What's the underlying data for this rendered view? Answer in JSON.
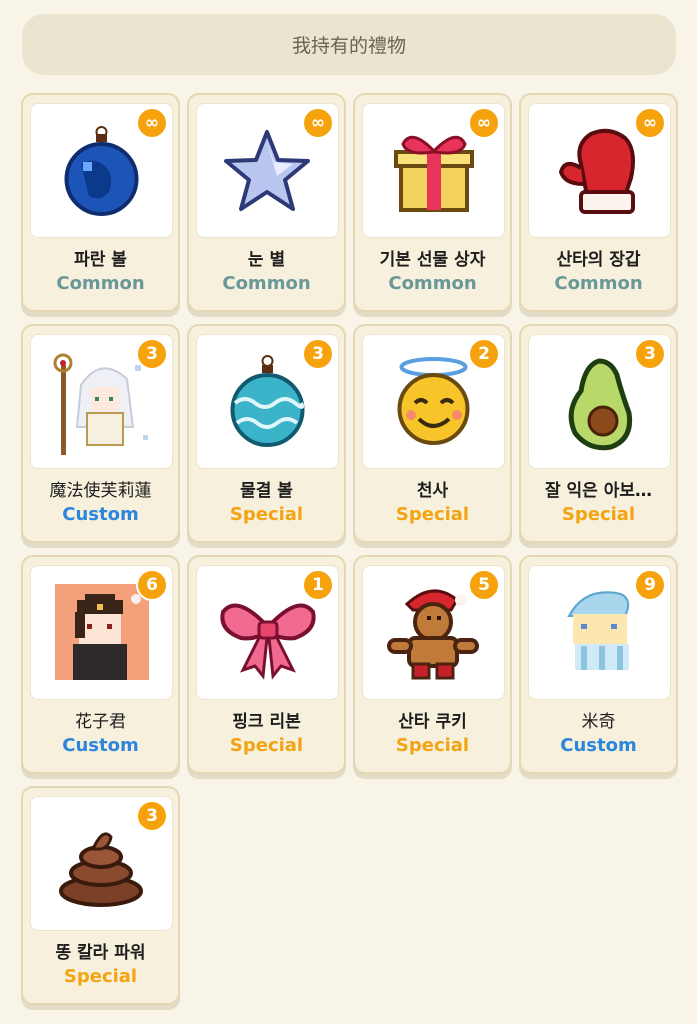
{
  "header": {
    "title": "我持有的禮物"
  },
  "items": [
    {
      "name": "파란 볼",
      "rarity": "Common",
      "count": "∞"
    },
    {
      "name": "눈 별",
      "rarity": "Common",
      "count": "∞"
    },
    {
      "name": "기본 선물 상자",
      "rarity": "Common",
      "count": "∞"
    },
    {
      "name": "산타의 장갑",
      "rarity": "Common",
      "count": "∞"
    },
    {
      "name": "魔法使芙莉蓮",
      "rarity": "Custom",
      "count": "3"
    },
    {
      "name": "물결 볼",
      "rarity": "Special",
      "count": "3"
    },
    {
      "name": "천사",
      "rarity": "Special",
      "count": "2"
    },
    {
      "name": "잘 익은 아보…",
      "rarity": "Special",
      "count": "3"
    },
    {
      "name": "花子君",
      "rarity": "Custom",
      "count": "6"
    },
    {
      "name": "핑크 리본",
      "rarity": "Special",
      "count": "1"
    },
    {
      "name": "산타 쿠키",
      "rarity": "Special",
      "count": "5"
    },
    {
      "name": "米奇",
      "rarity": "Custom",
      "count": "9"
    },
    {
      "name": "똥 칼라 파워",
      "rarity": "Special",
      "count": "3"
    }
  ],
  "icons": [
    "blue-ornament-icon",
    "snow-star-icon",
    "gift-box-icon",
    "santa-mitten-icon",
    "frieren-avatar-icon",
    "wave-ornament-icon",
    "angel-face-icon",
    "avocado-icon",
    "hanako-avatar-icon",
    "pink-ribbon-icon",
    "gingerbread-cookie-icon",
    "mickey-avatar-icon",
    "poop-icon"
  ],
  "colors": {
    "common": "#6a9898",
    "special": "#f2a412",
    "custom": "#2c86dd",
    "badge": "#f5a20d"
  }
}
